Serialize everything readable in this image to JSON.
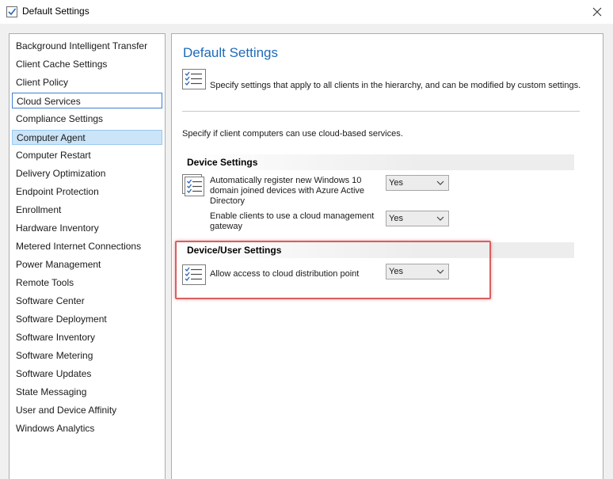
{
  "window": {
    "title": "Default Settings",
    "close_glyph": "✕"
  },
  "nav": {
    "items": [
      {
        "label": "Background Intelligent Transfer"
      },
      {
        "label": "Client Cache Settings"
      },
      {
        "label": "Client Policy"
      },
      {
        "label": "Cloud Services"
      },
      {
        "label": "Compliance Settings"
      },
      {
        "label": "Computer Agent"
      },
      {
        "label": "Computer Restart"
      },
      {
        "label": "Delivery Optimization"
      },
      {
        "label": "Endpoint Protection"
      },
      {
        "label": "Enrollment"
      },
      {
        "label": "Hardware Inventory"
      },
      {
        "label": "Metered Internet Connections"
      },
      {
        "label": "Power Management"
      },
      {
        "label": "Remote Tools"
      },
      {
        "label": "Software Center"
      },
      {
        "label": "Software Deployment"
      },
      {
        "label": "Software Inventory"
      },
      {
        "label": "Software Metering"
      },
      {
        "label": "Software Updates"
      },
      {
        "label": "State Messaging"
      },
      {
        "label": "User and Device Affinity"
      },
      {
        "label": "Windows Analytics"
      }
    ],
    "focused_item": "Cloud Services",
    "selected_item": "Computer Agent"
  },
  "main": {
    "title": "Default Settings",
    "description": "Specify settings that apply to all clients in the hierarchy, and can be modified by custom settings.",
    "intro": "Specify if client computers can use cloud-based services.",
    "device_section": {
      "header": "Device Settings",
      "settings": [
        {
          "label": "Automatically register new Windows 10 domain joined devices with Azure Active Directory",
          "value": "Yes"
        },
        {
          "label": "Enable clients to use a cloud management gateway",
          "value": "Yes"
        }
      ]
    },
    "user_section": {
      "header": "Device/User Settings",
      "settings": [
        {
          "label": "Allow access to cloud distribution point",
          "value": "Yes"
        }
      ]
    }
  },
  "colors": {
    "title_blue": "#1e6bb8",
    "selection_bg": "#cce4f7",
    "focus_border": "#3d7fd6",
    "highlight_red": "#d95f5f"
  },
  "icons": {
    "app": "checklist-app-icon",
    "settings": "checklist-icon",
    "close": "close-icon",
    "dropdown": "chevron-down-icon"
  }
}
